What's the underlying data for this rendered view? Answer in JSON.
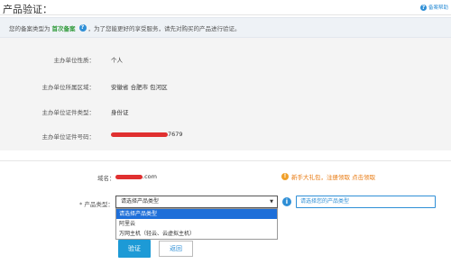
{
  "header": {
    "title": "产品验证：",
    "help_label": "备案帮助"
  },
  "notice": {
    "prefix": "您的备案类型为",
    "type": "首次备案",
    "suffix": "，为了您能更好的享受服务，请先对购买的产品进行验证。"
  },
  "info": {
    "rows": [
      {
        "label": "主办单位性质：",
        "value": "个人"
      },
      {
        "label": "主办单位所属区域：",
        "value": "安徽省 合肥市 包河区"
      },
      {
        "label": "主办单位证件类型：",
        "value": "身份证"
      },
      {
        "label": "主办单位证件号码：",
        "value": "7679"
      }
    ]
  },
  "domain": {
    "label": "域名：",
    "value_suffix": ".com",
    "promo": "新手大礼包，注册领取 点击领取"
  },
  "product": {
    "label": "* 产品类型：",
    "selected": "请选择产品类型",
    "options": [
      "请选择产品类型",
      "阿里云",
      "万网主机（轻云、云虚拟主机）"
    ],
    "hint_placeholder": "请选择您的产品类型"
  },
  "buttons": {
    "submit": "验证",
    "back": "返回"
  },
  "colors": {
    "accent": "#1d9ad6",
    "notice_type": "#2f9a3a",
    "promo": "#e8790f",
    "dropdown_highlight": "#1e6fd9"
  }
}
